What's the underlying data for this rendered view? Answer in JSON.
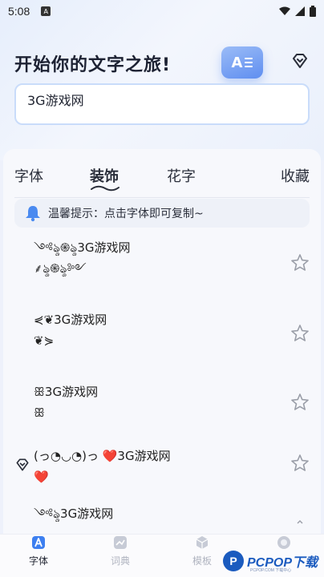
{
  "status_bar": {
    "time": "5:08",
    "app_badge": "A"
  },
  "header": {
    "title": "开始你的文字之旅!",
    "badge_text": "A"
  },
  "input": {
    "value": "3G游戏网"
  },
  "tabs": [
    {
      "label": "字体",
      "active": false
    },
    {
      "label": "装饰",
      "active": true
    },
    {
      "label": "花字",
      "active": false
    },
    {
      "label": "收藏",
      "active": false
    }
  ],
  "notice": {
    "text": "温馨提示：点击字体即可复制~"
  },
  "items": [
    {
      "text": "༺ৡ֍ৡ3G游戏网\n⸙ৡ֍ৡ༻",
      "vip": false
    },
    {
      "text": "⋞❦3G游戏网\n❦⋟",
      "vip": false
    },
    {
      "text": "ꕥ3G游戏网\nꕥ",
      "vip": false
    },
    {
      "text": "(っ◔◡◔)っ ❤️3G游戏网\n❤️",
      "vip": true
    },
    {
      "text": "༺ৡ3G游戏网",
      "vip": false
    }
  ],
  "bottom_nav": [
    {
      "label": "字体",
      "icon": "font-a-icon",
      "active": true
    },
    {
      "label": "词典",
      "icon": "dictionary-icon",
      "active": false
    },
    {
      "label": "模板",
      "icon": "template-cube-icon",
      "active": false
    },
    {
      "label": "",
      "icon": "profile-icon",
      "active": false
    }
  ],
  "watermark": {
    "brand": "PCPOP下载",
    "logo_letter": "P",
    "sub": "PCPOP.COM 下载中心"
  },
  "colors": {
    "accent": "#5f8ef0",
    "input_border": "#c9dcfa",
    "star": "#9a9ea8",
    "heart": "#e8313b"
  }
}
